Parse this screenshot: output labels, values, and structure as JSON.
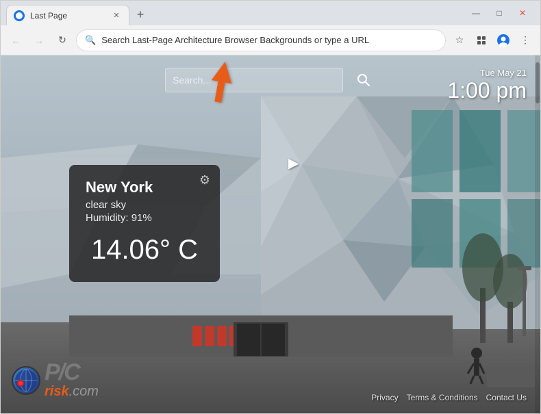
{
  "browser": {
    "tab": {
      "label": "Last Page",
      "favicon": "page-icon"
    },
    "new_tab_button": "+",
    "address_bar": {
      "url": "Search Last-Page Architecture Browser Backgrounds or type a URL",
      "icon": "search-icon"
    },
    "window_controls": {
      "minimize": "—",
      "maximize": "□",
      "close": "✕"
    }
  },
  "content": {
    "search": {
      "placeholder": "Search...",
      "icon": "search-icon"
    },
    "datetime": {
      "date": "Tue May 21",
      "time": "1:00 pm"
    },
    "weather": {
      "city": "New York",
      "condition": "clear sky",
      "humidity_label": "Humidity:",
      "humidity_value": "91%",
      "temperature": "14.06° C",
      "gear_icon": "gear-icon"
    },
    "footer": {
      "privacy": "Privacy",
      "terms": "Terms & Conditions",
      "contact": "Contact Us",
      "logo_pc": "P/C",
      "logo_brand": "risk",
      "logo_tld": ".com"
    }
  },
  "colors": {
    "accent_orange": "#e85c1a",
    "weather_bg": "rgba(30,30,30,0.82)",
    "tab_bg": "#f2f2f2",
    "nav_bg": "#f2f2f2"
  }
}
